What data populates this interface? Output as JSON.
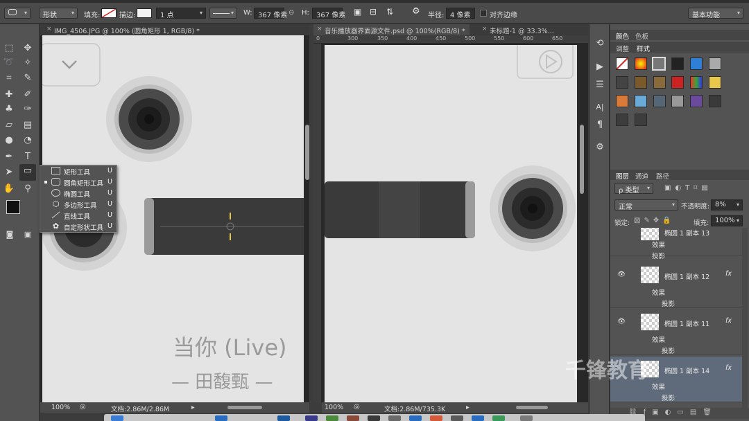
{
  "options_bar": {
    "mode": "形状",
    "fill_label": "填充:",
    "stroke_label": "描边:",
    "stroke_width": "1 点",
    "w_label": "W:",
    "w_value": "367 像素",
    "h_label": "H:",
    "h_value": "367 像素",
    "radius_label": "半径:",
    "radius_value": "4 像素",
    "align_edges": "对齐边缘",
    "workspace": "基本功能"
  },
  "documents": [
    {
      "tab": "IMG_4506.JPG @ 100% (圆角矩形 1, RGB/8) *",
      "zoom": "100%",
      "doc_size": "文档:2.86M/2.86M"
    },
    {
      "tab": "音乐播放器界面源文件.psd @ 100%(RGB/8) *",
      "zoom": "100%",
      "doc_size": "文档:2.86M/735.3K"
    },
    {
      "tab": "未标题-1 @ 33.3%..."
    }
  ],
  "ruler_ticks": [
    "0",
    "300",
    "350",
    "400",
    "450",
    "500",
    "550",
    "600",
    "650"
  ],
  "canvas_text": {
    "song": "当你 (Live)",
    "artist": "— 田馥甄 —"
  },
  "flyout": [
    {
      "label": "矩形工具",
      "key": "U",
      "icon": "rectangle-icon",
      "active": false
    },
    {
      "label": "圆角矩形工具",
      "key": "U",
      "icon": "rounded-rectangle-icon",
      "active": true
    },
    {
      "label": "椭圆工具",
      "key": "U",
      "icon": "ellipse-icon",
      "active": false
    },
    {
      "label": "多边形工具",
      "key": "U",
      "icon": "polygon-icon",
      "active": false
    },
    {
      "label": "直线工具",
      "key": "U",
      "icon": "line-icon",
      "active": false
    },
    {
      "label": "自定形状工具",
      "key": "U",
      "icon": "custom-shape-icon",
      "active": false
    }
  ],
  "panels": {
    "color_tabs": [
      "颜色",
      "色板"
    ],
    "adjust_tabs": [
      "调整",
      "样式"
    ],
    "layer_tabs": [
      "图层",
      "通道",
      "路径"
    ],
    "filter_kind": "ρ 类型",
    "blend_mode": "正常",
    "opacity_label": "不透明度:",
    "opacity_value": "8%",
    "lock_label": "锁定:",
    "fill_label": "填充:",
    "fill_value": "100%",
    "layers": [
      {
        "name": "椭圆 1 副本 13",
        "effects": "效果",
        "shadow": "投影"
      },
      {
        "name": "椭圆 1 副本 12",
        "effects": "效果",
        "shadow": "投影"
      },
      {
        "name": "椭圆 1 副本 11",
        "effects": "效果",
        "shadow": "投影"
      },
      {
        "name": "椭圆 1 副本 14",
        "effects": "效果",
        "shadow": "投影"
      }
    ]
  },
  "watermark": "千锋教育",
  "colors": {
    "ui_dark": "#535353",
    "canvas": "#e4e4e4",
    "accent_yellow": "#e8c74a"
  }
}
